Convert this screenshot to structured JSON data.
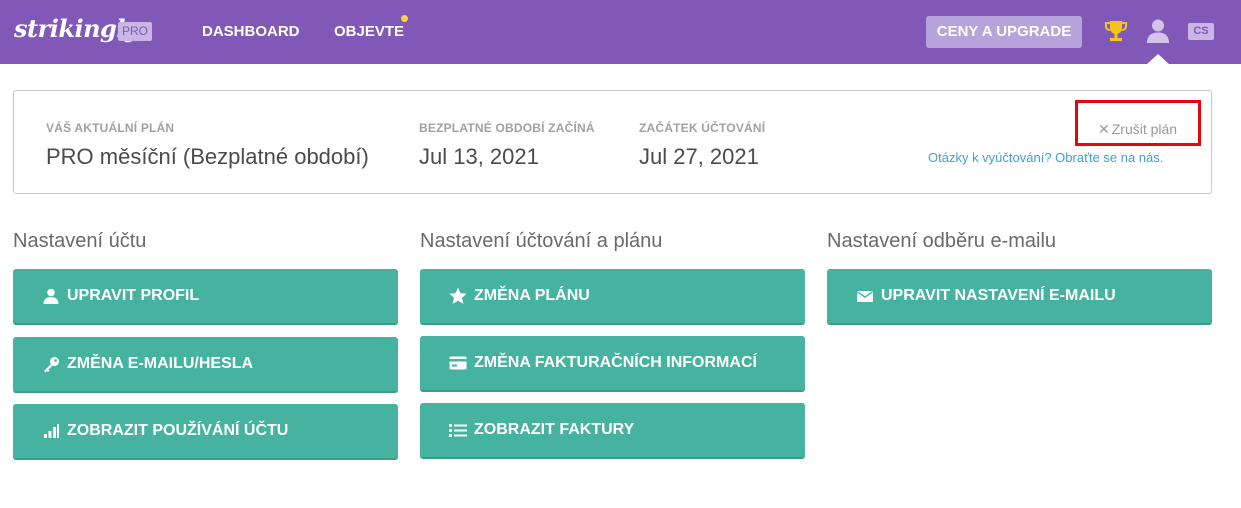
{
  "header": {
    "logo": "strikingly",
    "pro_badge": "PRO",
    "nav": [
      "DASHBOARD",
      "OBJEVTE"
    ],
    "upgrade_label": "CENY A UPGRADE",
    "lang": "CS"
  },
  "plan": {
    "current_label": "VÁŠ AKTUÁLNÍ PLÁN",
    "current_value": "PRO měsíční (Bezplatné období)",
    "free_label": "BEZPLATNÉ OBDOBÍ ZAČÍNÁ",
    "free_value": "Jul 13, 2021",
    "billing_label": "ZAČÁTEK ÚČTOVÁNÍ",
    "billing_value": "Jul 27, 2021",
    "cancel_label": "Zrušit plán",
    "contact_text": "Otázky k vyúčtování? Obraťte se na nás."
  },
  "sections": {
    "account": {
      "title": "Nastavení účtu",
      "buttons": [
        "UPRAVIT PROFIL",
        "ZMĚNA E-MAILU/HESLA",
        "ZOBRAZIT POUŽÍVÁNÍ ÚČTU"
      ]
    },
    "billing": {
      "title": "Nastavení účtování a plánu",
      "buttons": [
        "ZMĚNA PLÁNU",
        "ZMĚNA FAKTURAČNÍCH INFORMACÍ",
        "ZOBRAZIT FAKTURY"
      ]
    },
    "email": {
      "title": "Nastavení odběru e-mailu",
      "buttons": [
        "UPRAVIT NASTAVENÍ E-MAILU"
      ]
    }
  },
  "colors": {
    "topbar": "#8158b8",
    "button": "#45b39f",
    "annotation": "#e30613",
    "link": "#3fa0d8"
  }
}
